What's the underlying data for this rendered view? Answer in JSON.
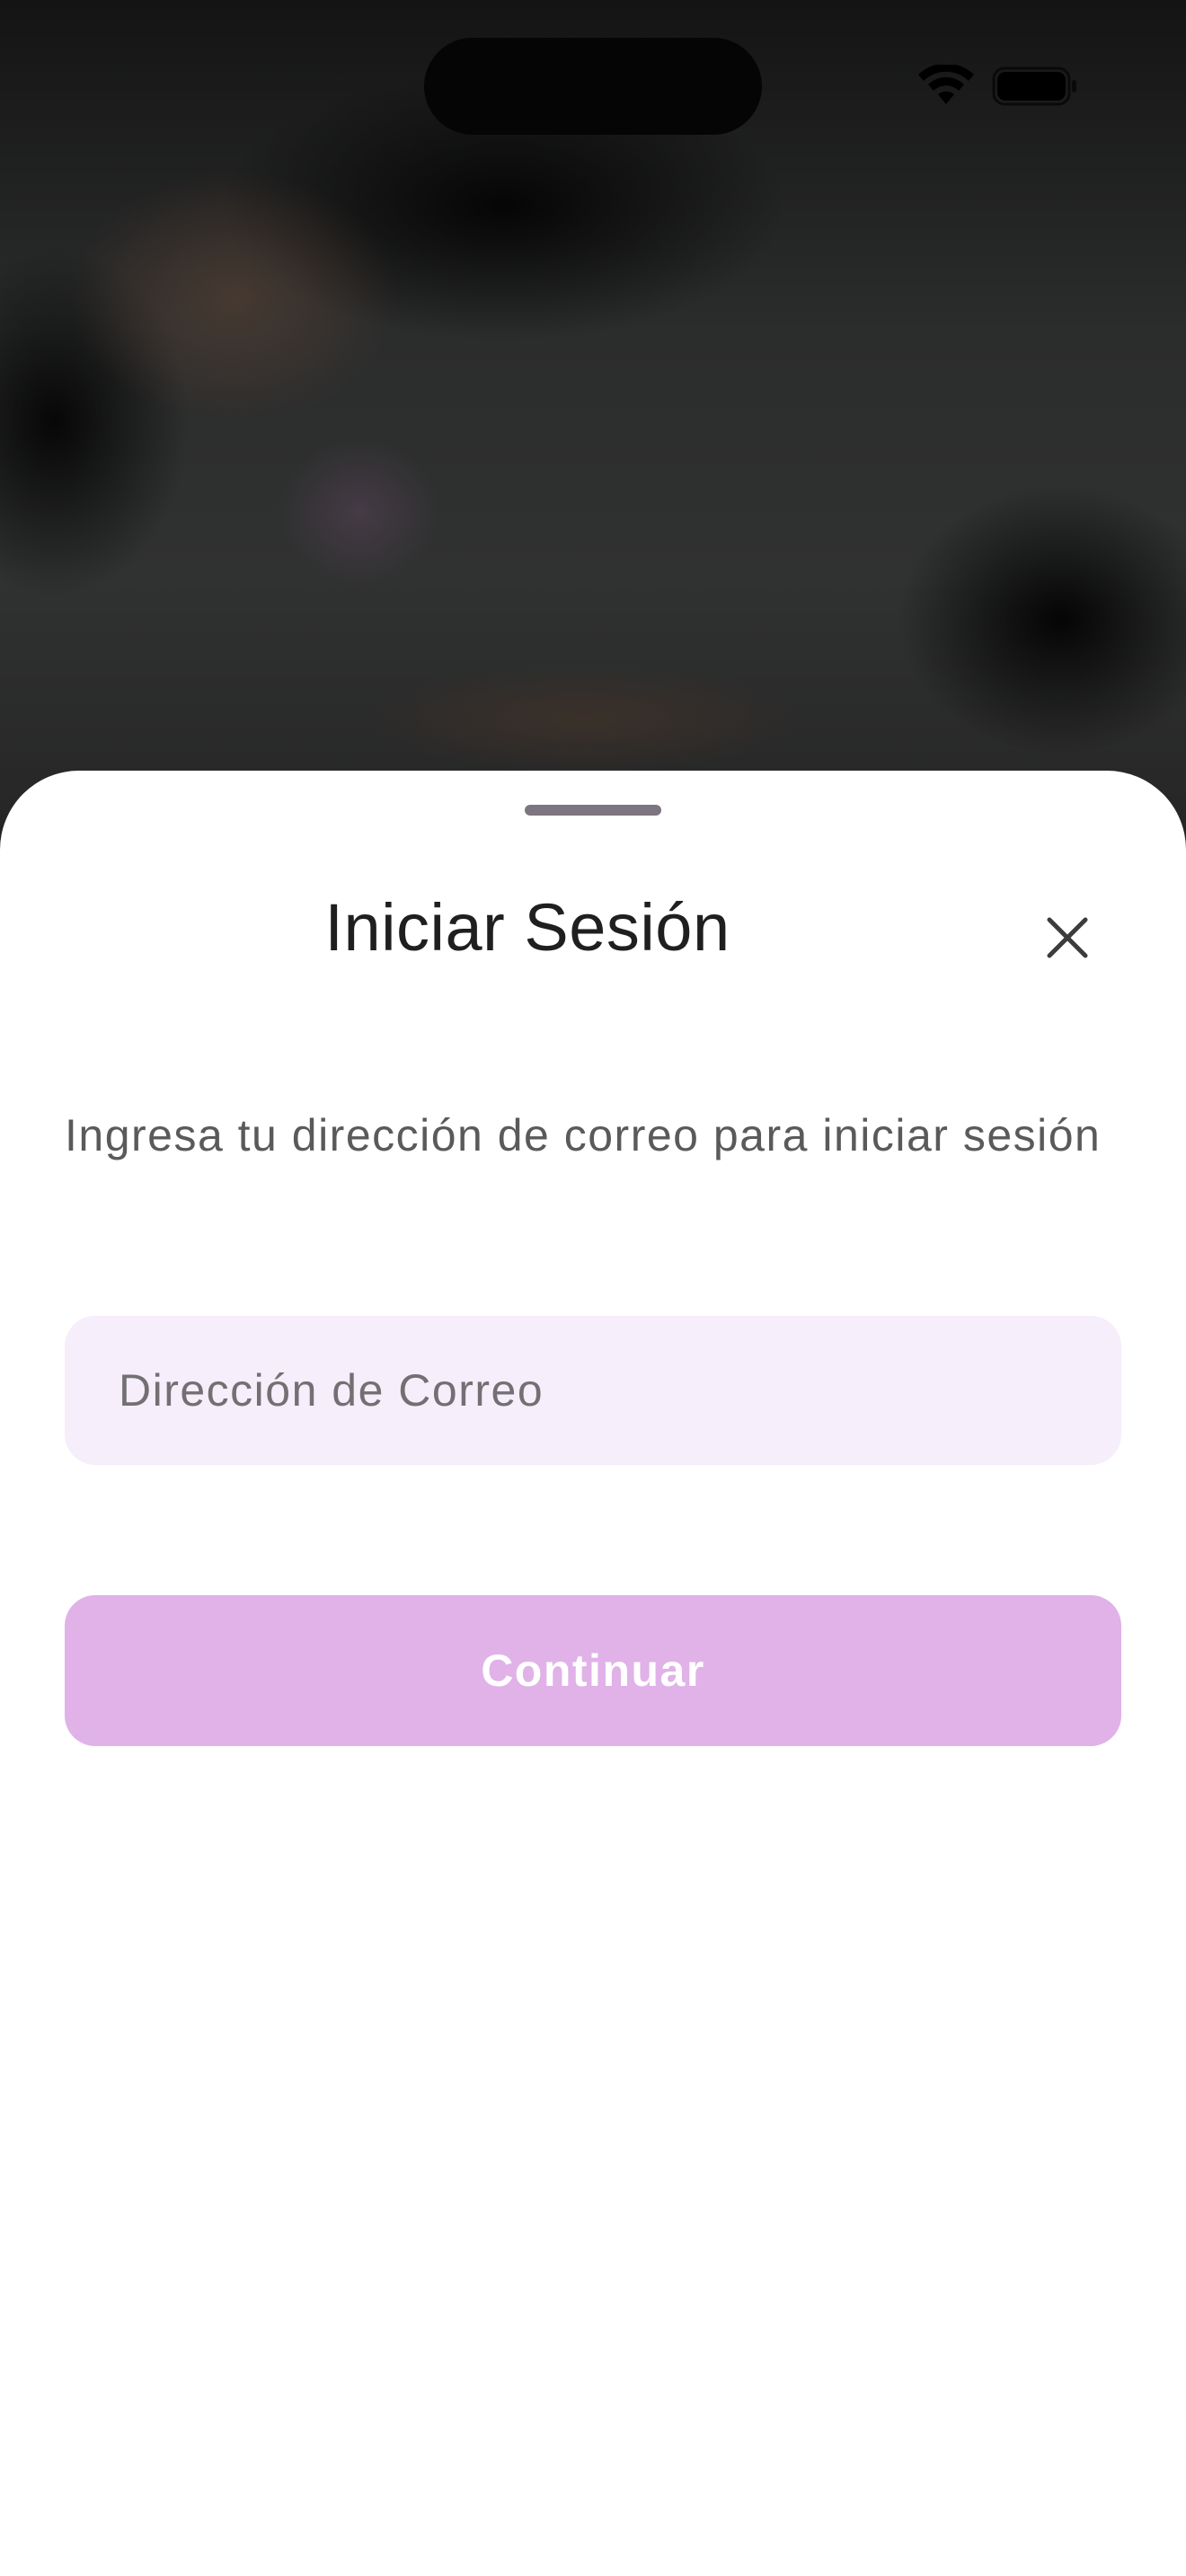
{
  "sheet": {
    "title": "Iniciar Sesión",
    "subtitle": "Ingresa tu dirección de correo para iniciar sesión",
    "email_placeholder": "Dirección de Correo",
    "email_value": "",
    "continue_label": "Continuar",
    "close_icon": "close-icon"
  },
  "status_bar": {
    "wifi_icon": "wifi-icon",
    "battery_icon": "battery-icon"
  },
  "colors": {
    "field_background": "#f6eefa",
    "button_background": "#e0b2e8",
    "button_text": "#ffffff",
    "title_text": "#1f1f1f"
  }
}
